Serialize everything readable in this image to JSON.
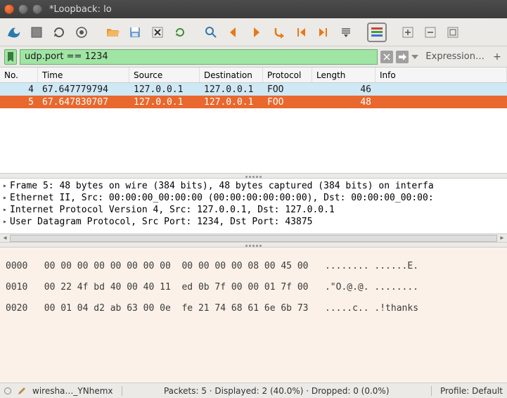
{
  "window": {
    "title": "*Loopback: lo"
  },
  "filter": {
    "value": "udp.port == 1234",
    "expression_label": "Expression…"
  },
  "columns": {
    "no": "No.",
    "time": "Time",
    "src": "Source",
    "dst": "Destination",
    "proto": "Protocol",
    "len": "Length",
    "info": "Info"
  },
  "packets": [
    {
      "no": "4",
      "time": "67.647779794",
      "src": "127.0.0.1",
      "dst": "127.0.0.1",
      "proto": "FOO",
      "len": "46",
      "info": ""
    },
    {
      "no": "5",
      "time": "67.647830707",
      "src": "127.0.0.1",
      "dst": "127.0.0.1",
      "proto": "FOO",
      "len": "48",
      "info": ""
    }
  ],
  "tree": [
    "Frame 5: 48 bytes on wire (384 bits), 48 bytes captured (384 bits) on interfa",
    "Ethernet II, Src: 00:00:00_00:00:00 (00:00:00:00:00:00), Dst: 00:00:00_00:00:",
    "Internet Protocol Version 4, Src: 127.0.0.1, Dst: 127.0.0.1",
    "User Datagram Protocol, Src Port: 1234, Dst Port: 43875"
  ],
  "hex": [
    {
      "off": "0000",
      "bytes": "00 00 00 00 00 00 00 00  00 00 00 00 08 00 45 00",
      "ascii": "........ ......E."
    },
    {
      "off": "0010",
      "bytes": "00 22 4f bd 40 00 40 11  ed 0b 7f 00 00 01 7f 00",
      "ascii": ".\"O.@.@. ........"
    },
    {
      "off": "0020",
      "bytes": "00 01 04 d2 ab 63 00 0e  fe 21 74 68 61 6e 6b 73",
      "ascii": ".....c.. .!thanks"
    }
  ],
  "status": {
    "file": "wiresha…_YNhemx",
    "stats": "Packets: 5 · Displayed: 2 (40.0%) · Dropped: 0 (0.0%)",
    "profile": "Profile: Default"
  }
}
